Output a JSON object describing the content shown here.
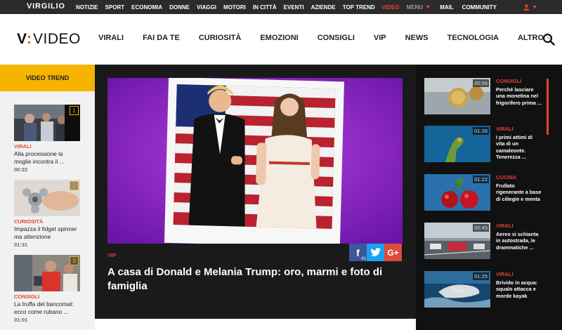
{
  "topbar": {
    "logo": "VIRGILIO",
    "nav": [
      "NOTIZIE",
      "SPORT",
      "ECONOMIA",
      "DONNE",
      "VIAGGI",
      "MOTORI",
      "IN CITTÀ",
      "EVENTI",
      "AZIENDE",
      "TOP TREND"
    ],
    "active": "VIDEO",
    "menu": "MENU",
    "mail": "MAIL",
    "community": "COMMUNITY"
  },
  "header": {
    "brand_v": "V",
    "brand_colon": ":",
    "brand_word": "VIDEO",
    "nav": [
      "VIRALI",
      "FAI DA TE",
      "CURIOSITÀ",
      "EMOZIONI",
      "CONSIGLI",
      "VIP",
      "NEWS",
      "TECNOLOGIA"
    ],
    "more": "ALTRO"
  },
  "sidebar": {
    "heading": "VIDEO TREND",
    "items": [
      {
        "num": "1",
        "category": "VIRALI",
        "title": "Alla processione la moglie incontra il ...",
        "duration": "00:22"
      },
      {
        "num": "2",
        "category": "CURIOSITÀ",
        "title": "Impazza il fidget spinner ma attenzione",
        "duration": "01:31"
      },
      {
        "num": "3",
        "category": "CONSIGLI",
        "title": "La truffa del bancomat: ecco come rubano ...",
        "duration": "01:01"
      }
    ]
  },
  "feature": {
    "category": "VIP",
    "title": "A casa di Donald e Melania Trump: oro, marmi e foto di famiglia",
    "share": {
      "fb": "f",
      "fb_count": "41",
      "tw": "t",
      "gp": "G+"
    }
  },
  "right_list": [
    {
      "duration": "00:56",
      "category": "CONSIGLI",
      "title": "Perché lasciare una monetina nel frigorifero prima ..."
    },
    {
      "duration": "01:26",
      "category": "VIRALI",
      "title": "I primi attimi di vita di un camaleonte. Tenerezza ..."
    },
    {
      "duration": "01:22",
      "category": "CUCINA",
      "title": "Frullato rigenerante a base di ciliegie e menta"
    },
    {
      "duration": "00:45",
      "category": "VIRALI",
      "title": "Aereo si schianta in autostrada, le drammatiche ..."
    },
    {
      "duration": "01:25",
      "category": "VIRALI",
      "title": "Brivido in acqua: squalo attacca e morde kayak"
    }
  ],
  "colors": {
    "accent": "#e2452f",
    "trend": "#f4b400",
    "dark": "#1a1a1a"
  }
}
